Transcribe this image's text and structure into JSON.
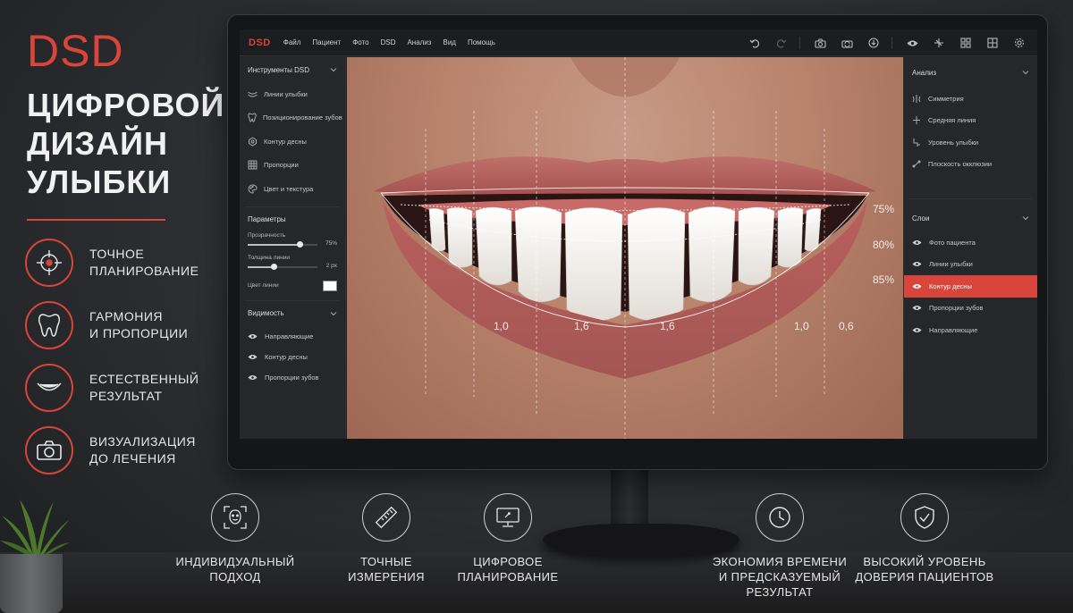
{
  "promo": {
    "logo": "DSD",
    "title": "ЦИФРОВОЙ ДИЗАЙН УЛЫБКИ",
    "accent_color": "#d8453a",
    "features": [
      {
        "icon": "crosshair-target-icon",
        "text": "ТОЧНОЕ\nПЛАНИРОВАНИЕ"
      },
      {
        "icon": "tooth-icon",
        "text": "ГАРМОНИЯ\nИ ПРОПОРЦИИ"
      },
      {
        "icon": "smile-icon",
        "text": "ЕСТЕСТВЕННЫЙ\nРЕЗУЛЬТАТ"
      },
      {
        "icon": "camera-icon",
        "text": "ВИЗУАЛИЗАЦИЯ\nДО ЛЕЧЕНИЯ"
      }
    ]
  },
  "app": {
    "logo": "DSD",
    "menu": [
      "Файл",
      "Пациент",
      "Фото",
      "DSD",
      "Анализ",
      "Вид",
      "Помощь"
    ],
    "toolbar": [
      "undo-icon",
      "redo-icon",
      "camera-icon",
      "camera-switch-icon",
      "import-icon",
      "eye-icon",
      "measure-icon",
      "grid-icon",
      "layout-icon",
      "settings-icon"
    ],
    "left_panel": {
      "tools_title": "Инструменты DSD",
      "tools": [
        {
          "icon": "smile-lines-icon",
          "label": "Линии улыбки"
        },
        {
          "icon": "tooth-icon",
          "label": "Позиционирование зубов"
        },
        {
          "icon": "gum-contour-icon",
          "label": "Контур десны"
        },
        {
          "icon": "grid-icon",
          "label": "Пропорции"
        },
        {
          "icon": "palette-icon",
          "label": "Цвет и текстура"
        }
      ],
      "params_title": "Параметры",
      "opacity_label": "Прозрачность",
      "opacity_value": "75%",
      "opacity_level": 0.75,
      "thickness_label": "Толщина линии",
      "thickness_value": "2 px",
      "thickness_level": 0.38,
      "line_color_label": "Цвет линии",
      "line_color": "#ffffff",
      "visibility_title": "Видимость",
      "visibility": [
        "Направляющие",
        "Контур десны",
        "Пропорции зубов"
      ]
    },
    "right_panel": {
      "analysis_title": "Анализ",
      "analysis": [
        {
          "icon": "symmetry-icon",
          "label": "Симметрия"
        },
        {
          "icon": "midline-icon",
          "label": "Средняя линия"
        },
        {
          "icon": "smile-level-icon",
          "label": "Уровень улыбки"
        },
        {
          "icon": "occlusion-plane-icon",
          "label": "Плоскость окклюзии"
        }
      ],
      "layers_title": "Слои",
      "layers": [
        {
          "label": "Фото пациента",
          "active": false
        },
        {
          "label": "Линии улыбки",
          "active": false
        },
        {
          "label": "Контур десны",
          "active": true
        },
        {
          "label": "Пропорции зубов",
          "active": false
        },
        {
          "label": "Направляющие",
          "active": false
        }
      ]
    },
    "canvas": {
      "percent_labels": [
        "75%",
        "80%",
        "85%"
      ],
      "ratio_labels": [
        "1,0",
        "1,6",
        "1,6",
        "1,0",
        "0,6"
      ]
    }
  },
  "bottom_features": [
    {
      "icon": "face-scan-icon",
      "text": "ИНДИВИДУАЛЬНЫЙ\nПОДХОД"
    },
    {
      "icon": "ruler-icon",
      "text": "ТОЧНЫЕ\nИЗМЕРЕНИЯ"
    },
    {
      "icon": "monitor-icon",
      "text": "ЦИФРОВОЕ\nПЛАНИРОВАНИЕ"
    },
    {
      "icon": "clock-icon",
      "text": "ЭКОНОМИЯ ВРЕМЕНИ\nИ ПРЕДСКАЗУЕМЫЙ\nРЕЗУЛЬТАТ"
    },
    {
      "icon": "shield-check-icon",
      "text": "ВЫСОКИЙ УРОВЕНЬ\nДОВЕРИЯ ПАЦИЕНТОВ"
    }
  ]
}
